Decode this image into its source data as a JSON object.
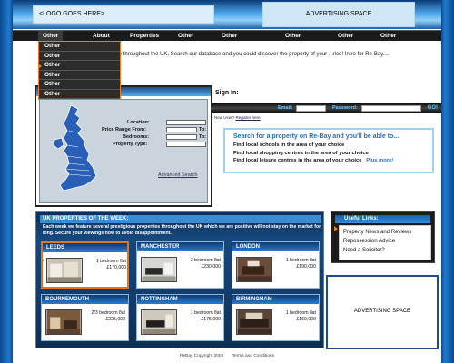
{
  "header": {
    "logo_text": "<LOGO GOES HERE>",
    "ad_text": "ADVERTISING SPACE"
  },
  "nav": {
    "items": [
      {
        "label": "Other"
      },
      {
        "label": "About"
      },
      {
        "label": "Properties"
      },
      {
        "label": "Other"
      },
      {
        "label": "Other"
      },
      {
        "label": "Other"
      },
      {
        "label": "Other"
      },
      {
        "label": "Other"
      }
    ]
  },
  "dropdown": {
    "items": [
      {
        "label": "Other"
      },
      {
        "label": "Other"
      },
      {
        "label": "Other"
      },
      {
        "label": "Other"
      },
      {
        "label": "Other"
      },
      {
        "label": "Other"
      }
    ]
  },
  "intro": "...ossessed properties for sale throughout the UK. Search our database and you could discover the property of your ...rice! Intro for Re-Bay....",
  "search": {
    "location_label": "Location:",
    "price_label": "Price Range From:",
    "to_label": "To:",
    "bedrooms_label": "Bedrooms:",
    "type_label": "Property Type:",
    "advanced_link": "Advanced Search"
  },
  "signin": {
    "title": "Sign In:",
    "email_label": "Email:",
    "password_label": "Password:",
    "go_label": "GO!",
    "new_user_text": "New User?",
    "register_link": "Register here"
  },
  "promo": {
    "title": "Search for a property on Re-Bay and you'll be able to...",
    "lines": [
      "Find local schools in the area of your choice",
      "Find local shopping centres in the area of your choice",
      "Find local leisure centres in the area of your choice"
    ],
    "more": "Plus more!"
  },
  "properties": {
    "title": "UK PROPERTIES OF THE WEEK:",
    "description": "Each week we feature several prestigious properties throughout the UK which we are positive will not stay on the market for long. Secure your viewings now to avoid disappointment.",
    "cards": [
      {
        "city": "LEEDS",
        "desc": "1 bedroom flat",
        "price": "£170,000"
      },
      {
        "city": "MANCHESTER",
        "desc": "3 bedroom flat",
        "price": "£230,000"
      },
      {
        "city": "LONDON",
        "desc": "1 bedroom flat",
        "price": "£190,000"
      },
      {
        "city": "BOURNEMOUTH",
        "desc": "2/3 bedroom flat",
        "price": "£225,000"
      },
      {
        "city": "NOTTINGHAM",
        "desc": "1 bedroom flat",
        "price": "£175,000"
      },
      {
        "city": "BIRMINGHAM",
        "desc": "1 bedroom flat",
        "price": "£169,000"
      }
    ]
  },
  "useful_links": {
    "title": "Useful Links:",
    "items": [
      "Property News and Reviews",
      "Repossession Advice",
      "Need a Solicitor?"
    ]
  },
  "side_ad": "ADVERTISING SPACE",
  "footer": {
    "copyright": "ReBay Copyright 2008",
    "terms": "Terms and Conditions"
  },
  "colors": {
    "accent": "#f07a1a",
    "brand_blue": "#1d6fc0",
    "nav_bg": "#1b1b1b"
  }
}
